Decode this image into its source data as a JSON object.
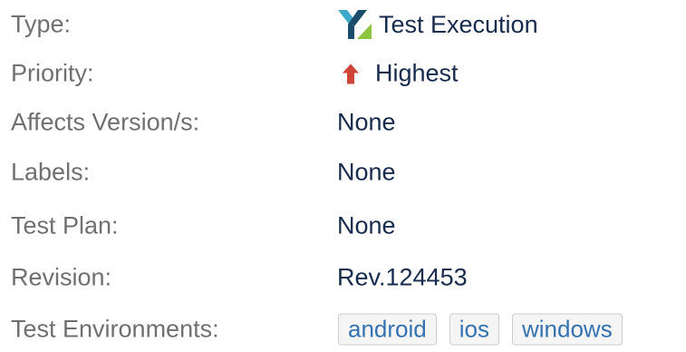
{
  "details": {
    "type": {
      "label": "Type:",
      "value": "Test Execution",
      "icon": "xray-test-execution-icon"
    },
    "priority": {
      "label": "Priority:",
      "value": "Highest",
      "icon": "arrow-up-icon",
      "color": "#d04437"
    },
    "affects_versions": {
      "label": "Affects Version/s:",
      "value": "None"
    },
    "labels": {
      "label": "Labels:",
      "value": "None"
    },
    "test_plan": {
      "label": "Test Plan:",
      "value": "None"
    },
    "revision": {
      "label": "Revision:",
      "value": "Rev.124453"
    },
    "test_environments": {
      "label": "Test Environments:",
      "tags": [
        "android",
        "ios",
        "windows"
      ]
    }
  },
  "colors": {
    "label_text": "#707070",
    "value_text": "#172b4d",
    "tag_text": "#3572b0",
    "tag_border": "#cccccc",
    "tag_background": "#f5f5f5",
    "icon_dark": "#1b4d6b",
    "icon_teal": "#3fa9c9",
    "icon_green": "#8dc63f"
  }
}
